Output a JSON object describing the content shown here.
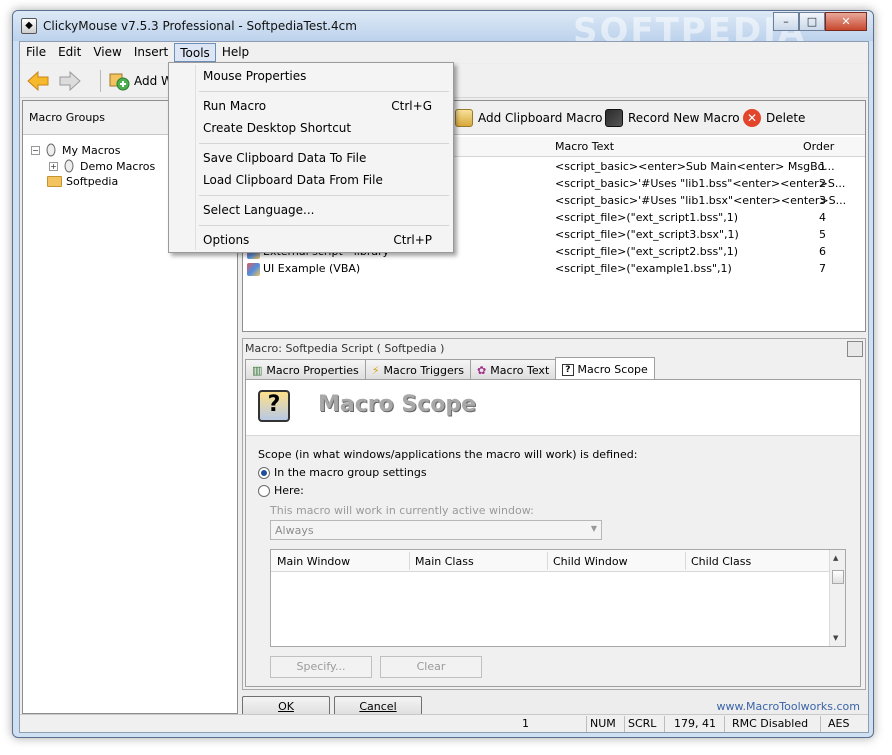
{
  "window": {
    "title": "ClickyMouse v7.5.3 Professional - SoftpediaTest.4cm",
    "watermark": "SOFTPEDIA"
  },
  "menubar": {
    "items": [
      "File",
      "Edit",
      "View",
      "Insert",
      "Tools",
      "Help"
    ],
    "active": "Tools"
  },
  "toolbar": {
    "add_label": "Add Wi"
  },
  "tools_menu": {
    "items": [
      {
        "label": "Mouse Properties",
        "shortcut": ""
      },
      {
        "label": "Run Macro",
        "shortcut": "Ctrl+G"
      },
      {
        "label": "Create Desktop Shortcut",
        "shortcut": ""
      },
      {
        "label": "Save Clipboard Data To File",
        "shortcut": ""
      },
      {
        "label": "Load Clipboard Data From File",
        "shortcut": ""
      },
      {
        "label": "Select Language...",
        "shortcut": ""
      },
      {
        "label": "Options",
        "shortcut": "Ctrl+P"
      }
    ]
  },
  "left_pane": {
    "header": "Macro Groups",
    "tree": [
      "My Macros",
      "Demo Macros",
      "Softpedia"
    ]
  },
  "macro_toolbar": {
    "add_clipboard": "Add Clipboard Macro",
    "record_new": "Record New Macro",
    "delete": "Delete"
  },
  "macro_list": {
    "headers": {
      "text": "Macro Text",
      "order": "Order"
    },
    "rows": [
      {
        "name": "",
        "text": "<script_basic><enter>Sub Main<enter>   MsgBo...",
        "order": "1"
      },
      {
        "name": "",
        "text": "<script_basic>'#Uses \"lib1.bss\"<enter><enter>S...",
        "order": "2"
      },
      {
        "name": "",
        "text": "<script_basic>'#Uses \"lib1.bsx\"<enter><enter>S...",
        "order": "3"
      },
      {
        "name": "",
        "text": "<script_file>(\"ext_script1.bss\",1)",
        "order": "4"
      },
      {
        "name": "",
        "text": "<script_file>(\"ext_script3.bsx\",1)",
        "order": "5"
      },
      {
        "name": "External script - library",
        "text": "<script_file>(\"ext_script2.bss\",1)",
        "order": "6"
      },
      {
        "name": "UI Example (VBA)",
        "text": "<script_file>(\"example1.bss\",1)",
        "order": "7"
      }
    ]
  },
  "macro_panel": {
    "caption": "Macro: Softpedia Script ( Softpedia )",
    "tabs": [
      "Macro Properties",
      "Macro Triggers",
      "Macro Text",
      "Macro Scope"
    ],
    "active_tab": "Macro Scope",
    "scope_title": "Macro Scope",
    "scope_desc": "Scope (in what windows/applications the macro will work) is defined:",
    "radio_group": "In the macro group settings",
    "radio_here": "Here:",
    "disabled_hint": "This macro will work in currently active window:",
    "combo_value": "Always",
    "grid_headers": [
      "Main Window",
      "Main Class",
      "Child Window",
      "Child Class"
    ],
    "specify_btn": "Specify...",
    "clear_btn": "Clear"
  },
  "dialog": {
    "ok": "OK",
    "cancel": "Cancel",
    "link": "www.MacroToolworks.com"
  },
  "statusbar": {
    "count": "1",
    "num": "NUM",
    "scrl": "SCRL",
    "coords": "179, 41",
    "rmc": "RMC Disabled",
    "aes": "AES"
  }
}
